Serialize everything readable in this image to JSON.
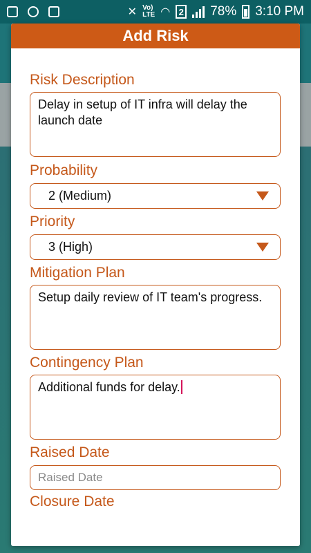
{
  "status_bar": {
    "battery": "78%",
    "time": "3:10 PM",
    "sim_slot": "2"
  },
  "dialog": {
    "title": "Add Risk",
    "risk_description": {
      "label": "Risk Description",
      "value": "Delay in setup of IT infra will delay the launch date"
    },
    "probability": {
      "label": "Probability",
      "selected": "2 (Medium)"
    },
    "priority": {
      "label": "Priority",
      "selected": "3 (High)"
    },
    "mitigation_plan": {
      "label": "Mitigation Plan",
      "value": "Setup daily review of IT team's progress."
    },
    "contingency_plan": {
      "label": "Contingency Plan",
      "value": "Additional funds for delay."
    },
    "raised_date": {
      "label": "Raised Date",
      "placeholder": "Raised Date"
    },
    "closure_date": {
      "label": "Closure Date"
    }
  },
  "colors": {
    "accent": "#cd5a16",
    "status_bar": "#0d5f63"
  }
}
